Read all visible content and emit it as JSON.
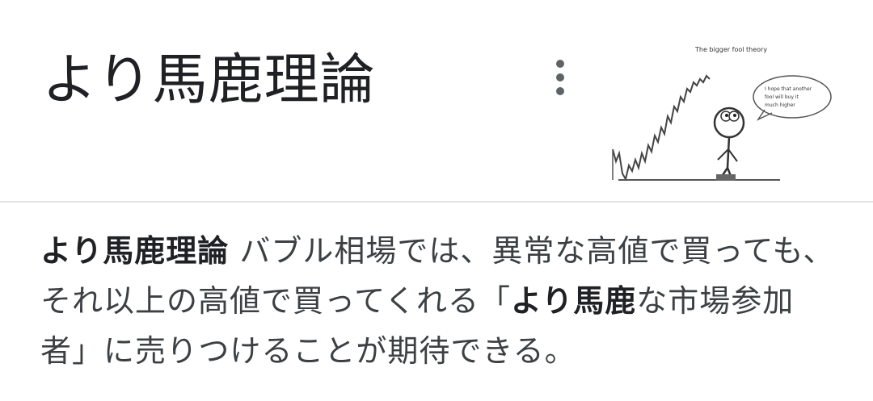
{
  "header": {
    "title": "より馬鹿理論",
    "more_icon": "more-vert-icon"
  },
  "thumbnail": {
    "caption": "The bigger fool theory",
    "speech": [
      "I hope that another",
      "fool will buy it",
      "much higher"
    ]
  },
  "snippet": {
    "term": "より馬鹿理論",
    "text_1": " バブル相場では、異常な高値で買っても、それ以上の高値で買ってくれる「",
    "highlight": "より馬鹿",
    "text_2": "な市場参加者」に売りつけることが期待できる。"
  },
  "colors": {
    "title": "#202124",
    "body": "#3c4043",
    "icon": "#5f6368",
    "divider": "#e3e3e3"
  }
}
